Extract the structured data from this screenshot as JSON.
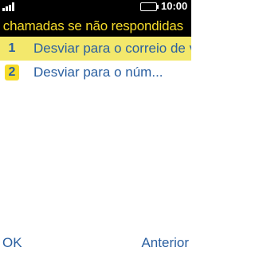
{
  "status_bar": {
    "time": "10:00",
    "signal_icon": "signal-bars-icon",
    "battery_icon": "battery-icon"
  },
  "title": "e chamadas se não respondidas",
  "menu": {
    "items": [
      {
        "index": "1",
        "label": "Desviar para o correio de voz",
        "selected": true
      },
      {
        "index": "2",
        "label": "Desviar para o núm...",
        "selected": false
      }
    ]
  },
  "softkeys": {
    "left": "OK",
    "right": "Anterior"
  },
  "colors": {
    "title_text": "#f6dc2a",
    "selection_bg": "#f3e86c",
    "item_text": "#2a5fa0",
    "status_bg": "#000000"
  }
}
